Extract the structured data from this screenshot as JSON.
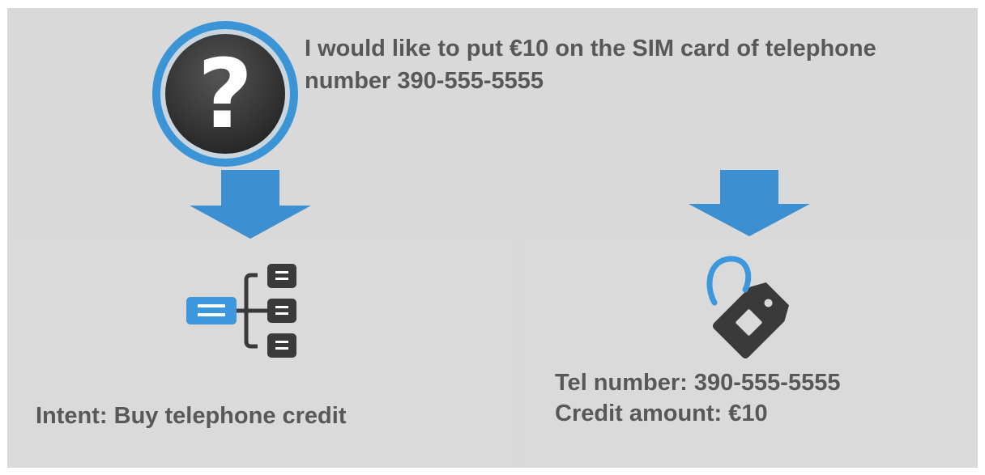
{
  "utterance": {
    "text": "I would like to put €10 on the SIM card of telephone number 390-555-5555"
  },
  "intent": {
    "label": "Intent: Buy telephone credit"
  },
  "entities": {
    "items": [
      "Tel number: 390-555-5555",
      "Credit amount: €10"
    ]
  },
  "icons": {
    "question": "question-mark-icon",
    "arrow_left": "arrow-down-icon",
    "arrow_right": "arrow-down-icon",
    "intent": "hierarchy-tree-icon",
    "entity": "tag-icon"
  },
  "colors": {
    "background": "#d9d9d9",
    "accent_blue": "#3c8fd0",
    "icon_dark": "#3a3a3a",
    "text": "#585858"
  }
}
